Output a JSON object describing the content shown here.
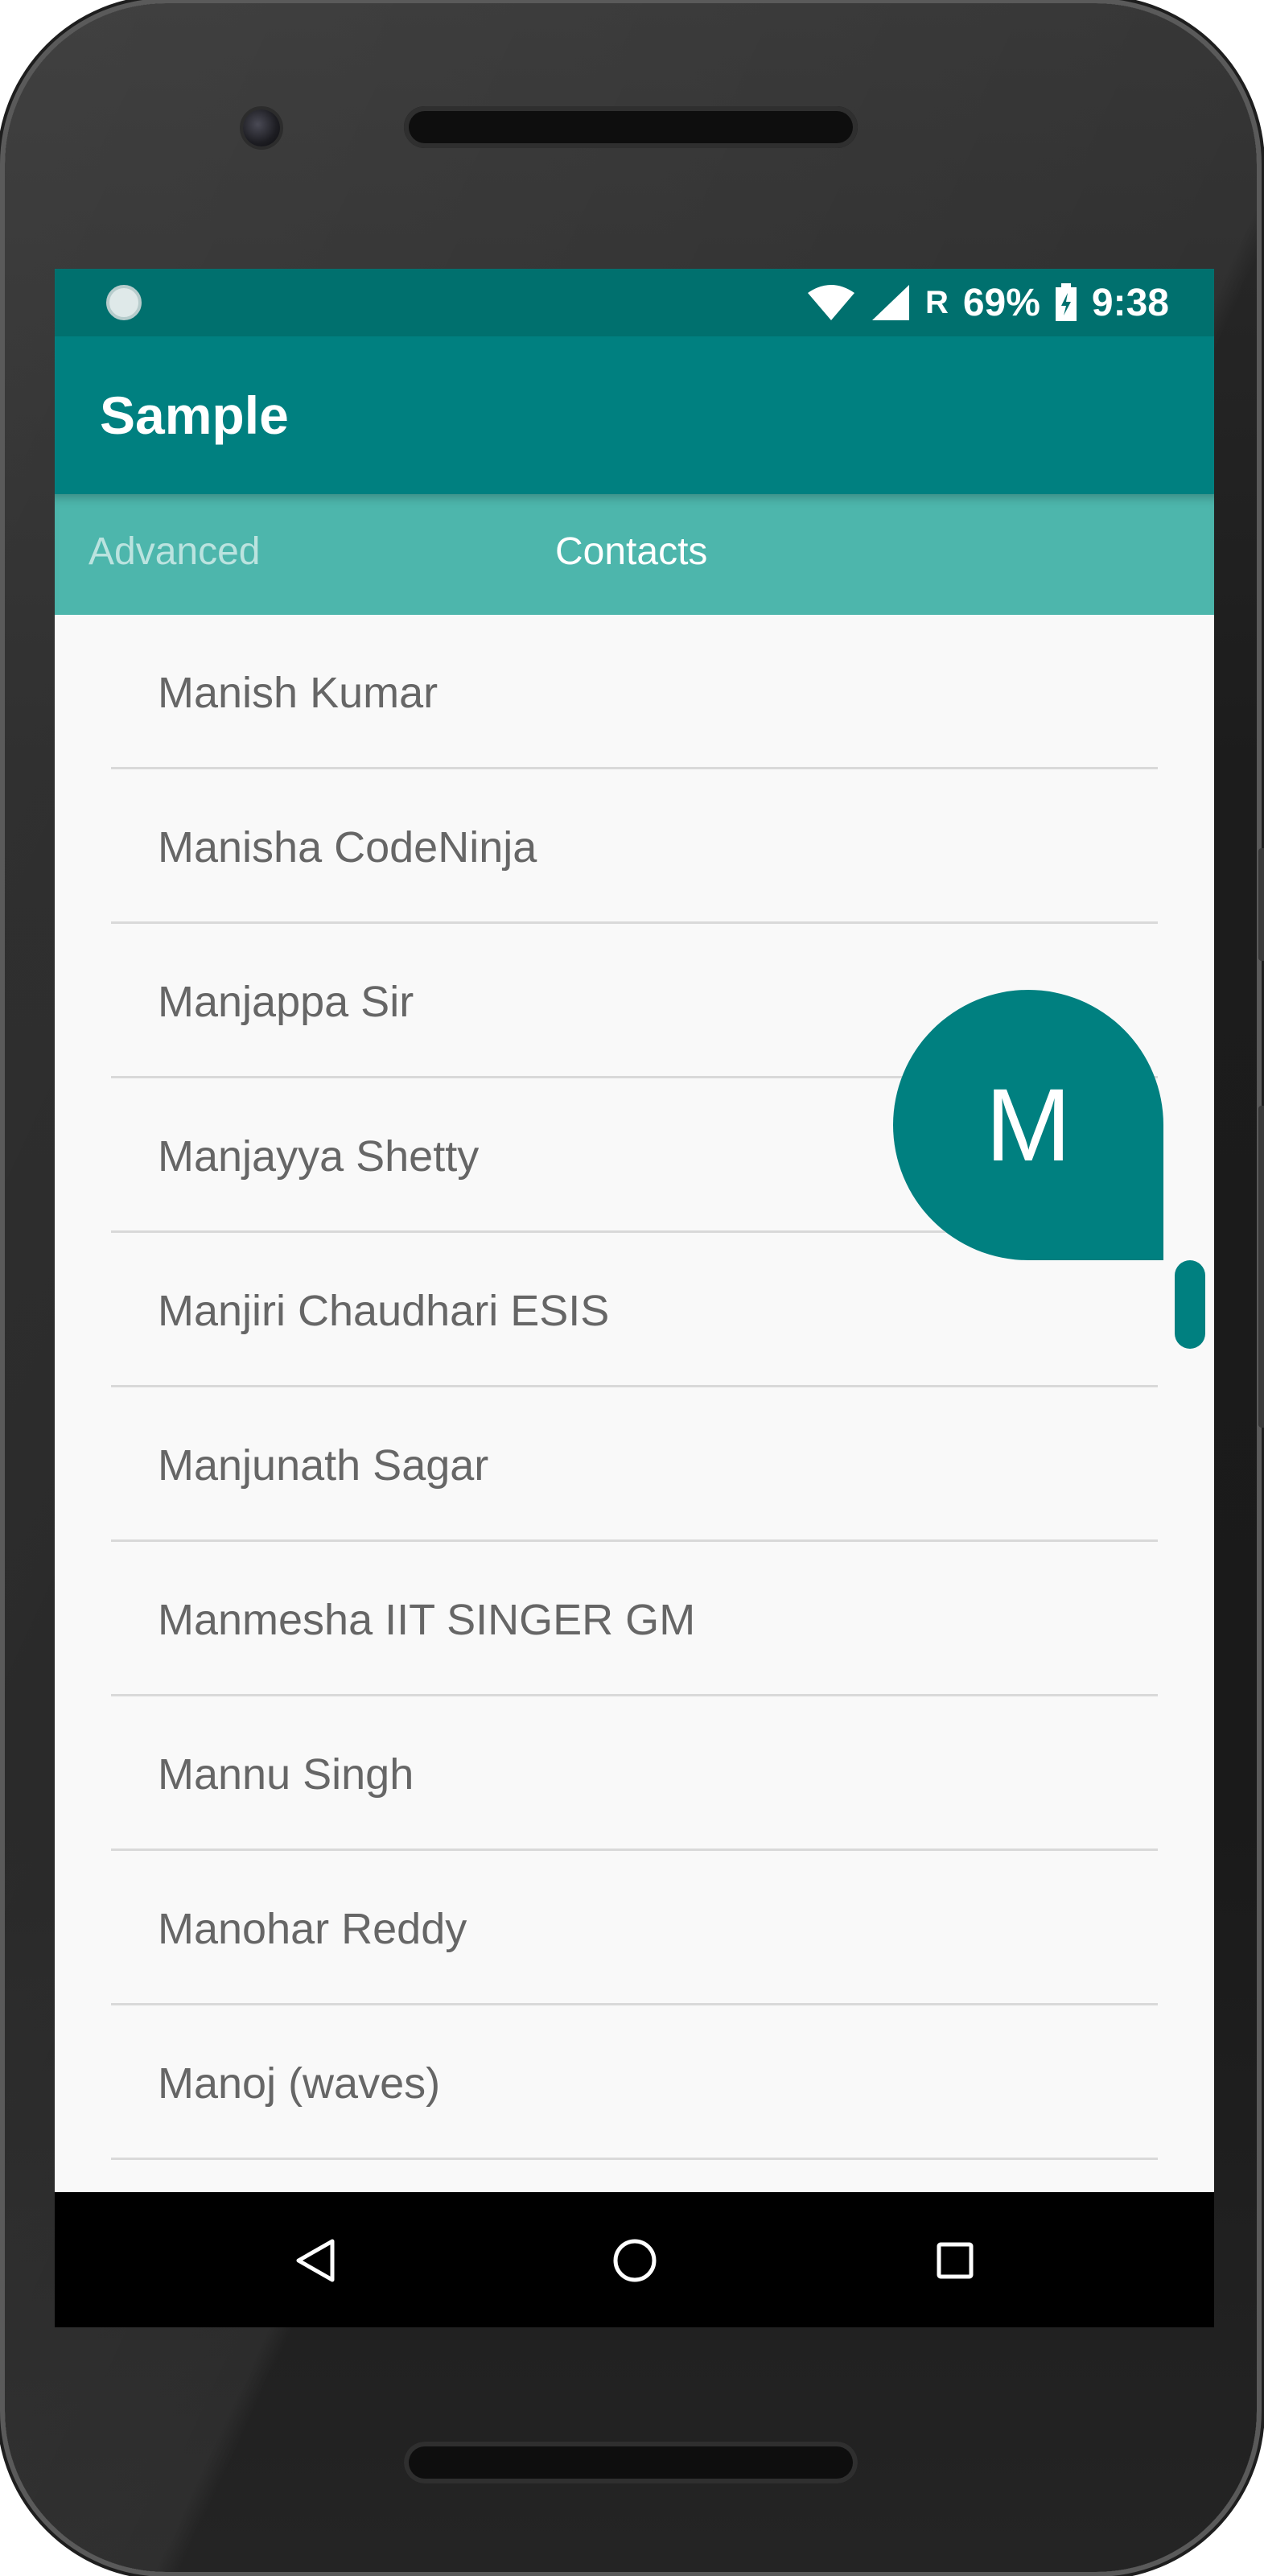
{
  "status_bar": {
    "roaming": "R",
    "battery": "69%",
    "time": "9:38",
    "icons": [
      "notification-dot-icon",
      "wifi-icon",
      "cell-signal-icon",
      "battery-charging-icon"
    ]
  },
  "app_bar": {
    "title": "Sample"
  },
  "tabs": [
    {
      "label": "Advanced",
      "selected": false
    },
    {
      "label": "Contacts",
      "selected": true
    }
  ],
  "contacts": [
    "Manish Kumar",
    "Manisha CodeNinja",
    "Manjappa Sir",
    "Manjayya Shetty",
    "Manjiri Chaudhari ESIS",
    "Manjunath Sagar",
    "Manmesha IIT SINGER GM",
    "Mannu Singh",
    "Manohar Reddy",
    "Manoj (waves)"
  ],
  "fast_scroll": {
    "letter": "M"
  },
  "nav_bar": {
    "icons": [
      "back-icon",
      "home-icon",
      "recents-icon"
    ]
  },
  "colors": {
    "primary_dark": "#00706e",
    "primary": "#008080",
    "tab_background": "#4db6ac",
    "list_background": "#f9f9f9",
    "text": "#666666"
  }
}
